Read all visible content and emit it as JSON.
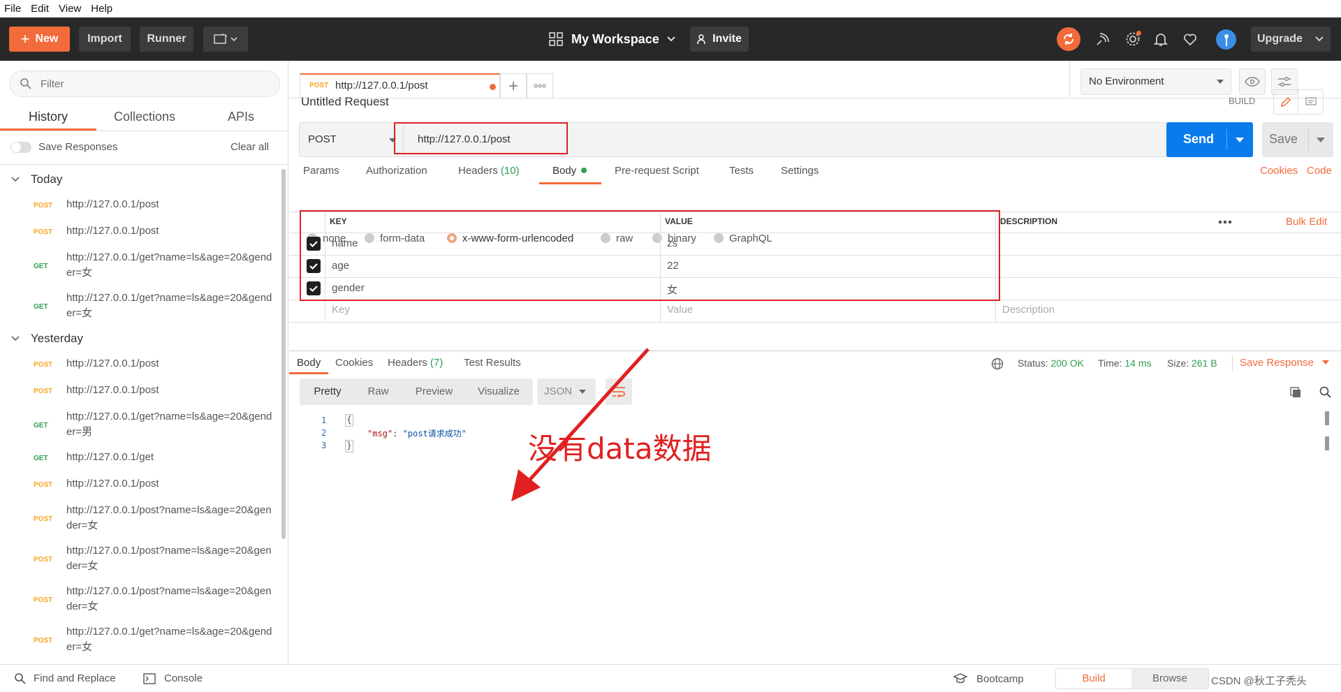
{
  "menu": [
    "File",
    "Edit",
    "View",
    "Help"
  ],
  "toolbar": {
    "new": "New",
    "import": "Import",
    "runner": "Runner",
    "workspace": "My Workspace",
    "invite": "Invite",
    "upgrade": "Upgrade"
  },
  "sidebar": {
    "filter_placeholder": "Filter",
    "tabs": [
      "History",
      "Collections",
      "APIs"
    ],
    "save_responses": "Save Responses",
    "clear_all": "Clear all",
    "groups": [
      {
        "title": "Today",
        "items": [
          {
            "method": "POST",
            "url": "http://127.0.0.1/post"
          },
          {
            "method": "POST",
            "url": "http://127.0.0.1/post"
          },
          {
            "method": "GET",
            "url": "http://127.0.0.1/get?name=ls&age=20&gender=女"
          },
          {
            "method": "GET",
            "url": "http://127.0.0.1/get?name=ls&age=20&gender=女"
          }
        ]
      },
      {
        "title": "Yesterday",
        "items": [
          {
            "method": "POST",
            "url": "http://127.0.0.1/post"
          },
          {
            "method": "POST",
            "url": "http://127.0.0.1/post"
          },
          {
            "method": "GET",
            "url": "http://127.0.0.1/get?name=ls&age=20&gender=男"
          },
          {
            "method": "GET",
            "url": "http://127.0.0.1/get"
          },
          {
            "method": "POST",
            "url": "http://127.0.0.1/post"
          },
          {
            "method": "POST",
            "url": "http://127.0.0.1/post?name=ls&age=20&gender=女"
          },
          {
            "method": "POST",
            "url": "http://127.0.0.1/post?name=ls&age=20&gender=女"
          },
          {
            "method": "POST",
            "url": "http://127.0.0.1/post?name=ls&age=20&gender=女"
          },
          {
            "method": "POST",
            "url": "http://127.0.0.1/get?name=ls&age=20&gender=女"
          }
        ]
      }
    ]
  },
  "tab": {
    "method": "POST",
    "url": "http://127.0.0.1/post"
  },
  "env": "No Environment",
  "request": {
    "title": "Untitled Request",
    "build": "BUILD",
    "method": "POST",
    "url": "http://127.0.0.1/post",
    "send": "Send",
    "save": "Save"
  },
  "req_tabs": {
    "params": "Params",
    "authorization": "Authorization",
    "headers": "Headers",
    "headers_count": "(10)",
    "body": "Body",
    "prerequest": "Pre-request Script",
    "tests": "Tests",
    "settings": "Settings",
    "cookies": "Cookies",
    "code": "Code"
  },
  "body_types": [
    "none",
    "form-data",
    "x-www-form-urlencoded",
    "raw",
    "binary",
    "GraphQL"
  ],
  "table": {
    "key_header": "KEY",
    "value_header": "VALUE",
    "desc_header": "DESCRIPTION",
    "bulk_edit": "Bulk Edit",
    "rows": [
      {
        "key": "name",
        "value": "zs"
      },
      {
        "key": "age",
        "value": "22"
      },
      {
        "key": "gender",
        "value": "女"
      }
    ],
    "key_placeholder": "Key",
    "value_placeholder": "Value",
    "desc_placeholder": "Description"
  },
  "response": {
    "tabs": [
      "Body",
      "Cookies",
      "Headers",
      "Test Results"
    ],
    "headers_count": "(7)",
    "status_label": "Status:",
    "status": "200 OK",
    "time_label": "Time:",
    "time": "14 ms",
    "size_label": "Size:",
    "size": "261 B",
    "save_response": "Save Response",
    "views": [
      "Pretty",
      "Raw",
      "Preview",
      "Visualize"
    ],
    "format": "JSON",
    "lines": [
      "1",
      "2",
      "3"
    ],
    "code_open": "{",
    "code_key": "\"msg\"",
    "code_colon": ": ",
    "code_value": "\"post请求成功\"",
    "code_close": "}"
  },
  "annotation": "没有data数据",
  "statusbar": {
    "find": "Find and Replace",
    "console": "Console",
    "bootcamp": "Bootcamp",
    "build": "Build",
    "browse": "Browse",
    "watermark": "CSDN @秋工子秃头"
  },
  "colors": {
    "accent": "#f26b3a",
    "send": "#097bed",
    "post": "#f5a623",
    "get": "#2e9f51",
    "annotation": "#e02020"
  }
}
